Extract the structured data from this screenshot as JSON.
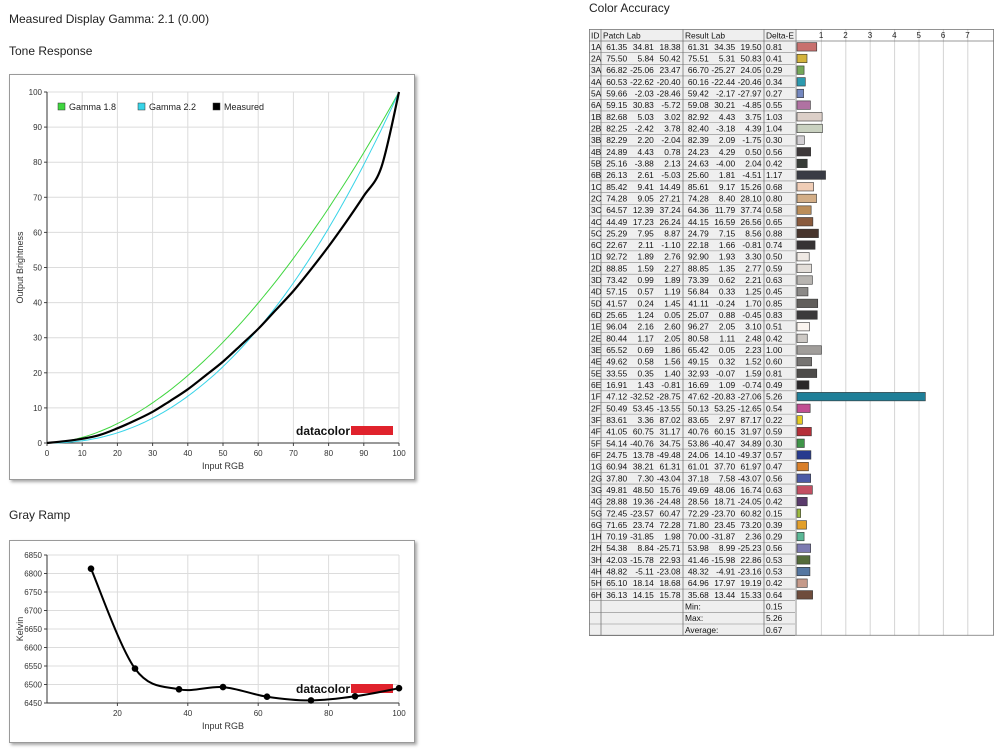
{
  "measured_gamma": "Measured Display Gamma: 2.1 (0.00)",
  "tone_response": {
    "heading": "Tone Response",
    "brand": "datacolor",
    "chart_data": {
      "type": "line",
      "title": "",
      "xlabel": "Input RGB",
      "ylabel": "Output Brightness",
      "xlim": [
        0,
        100
      ],
      "ylim": [
        0,
        100
      ],
      "xticks": [
        0,
        10,
        20,
        30,
        40,
        50,
        60,
        70,
        80,
        90,
        100
      ],
      "yticks": [
        0,
        10,
        20,
        30,
        40,
        50,
        60,
        70,
        80,
        90,
        100
      ],
      "grid": true,
      "legend_position": "top-left",
      "series": [
        {
          "name": "Gamma 1.8",
          "color": "#3fd63f",
          "gamma": 1.8
        },
        {
          "name": "Gamma 2.2",
          "color": "#38d4e8",
          "gamma": 2.2
        },
        {
          "name": "Measured",
          "color": "#000000",
          "x": [
            0,
            5,
            10,
            15,
            20,
            25,
            30,
            35,
            40,
            45,
            50,
            55,
            60,
            65,
            70,
            75,
            80,
            85,
            90,
            95,
            100
          ],
          "y": [
            0,
            0.5,
            1.2,
            2.3,
            4.2,
            6.4,
            8.9,
            12.0,
            15.3,
            19.2,
            23.2,
            27.8,
            32.5,
            37.9,
            43.3,
            49.5,
            56.0,
            63.0,
            70.4,
            78.6,
            100
          ]
        }
      ]
    }
  },
  "gray_ramp": {
    "heading": "Gray Ramp",
    "brand": "datacolor",
    "chart_data": {
      "type": "line",
      "title": "",
      "xlabel": "Input RGB",
      "ylabel": "Kelvin",
      "xlim": [
        0,
        100
      ],
      "ylim": [
        6450,
        6850
      ],
      "xticks": [
        20,
        40,
        60,
        80,
        100
      ],
      "yticks": [
        6450,
        6500,
        6550,
        6600,
        6650,
        6700,
        6750,
        6800,
        6850
      ],
      "grid": true,
      "series": [
        {
          "color": "#000000",
          "x": [
            12.5,
            25,
            37.5,
            50,
            62.5,
            75,
            87.5,
            100
          ],
          "y": [
            6813,
            6543,
            6487,
            6493,
            6467,
            6457,
            6468,
            6490
          ]
        }
      ]
    }
  },
  "color_accuracy": {
    "heading": "Color Accuracy",
    "col_id": "ID",
    "col_patch": "Patch Lab",
    "col_result": "Result Lab",
    "col_delta": "Delta-E",
    "scale_ticks": [
      "1",
      "2",
      "3",
      "4",
      "5",
      "6",
      "7"
    ],
    "summary": [
      {
        "label": "Min:",
        "value": "0.15"
      },
      {
        "label": "Max:",
        "value": "5.26"
      },
      {
        "label": "Average:",
        "value": "0.67"
      }
    ],
    "chart_data": {
      "type": "table",
      "columns": [
        "ID",
        "Patch Lab",
        "Result Lab",
        "Delta-E"
      ],
      "bar_axis": {
        "min": 0,
        "max": 7
      },
      "rows": [
        {
          "id": "1A",
          "patch": "61.35 34.81 18.38",
          "result": "61.31 34.35 19.50",
          "delta": "0.81",
          "color": "#c8706e"
        },
        {
          "id": "2A",
          "patch": "75.50 5.84 50.42",
          "result": "75.51 5.31 50.83",
          "delta": "0.41",
          "color": "#d4b33c"
        },
        {
          "id": "3A",
          "patch": "66.82 -25.06 23.47",
          "result": "66.70 -25.27 24.05",
          "delta": "0.29",
          "color": "#75a85a"
        },
        {
          "id": "4A",
          "patch": "60.53 -22.62 -20.40",
          "result": "60.16 -22.44 -20.46",
          "delta": "0.34",
          "color": "#2c9aaf"
        },
        {
          "id": "5A",
          "patch": "59.66 -2.03 -28.46",
          "result": "59.42 -2.17 -27.97",
          "delta": "0.27",
          "color": "#7488c0"
        },
        {
          "id": "6A",
          "patch": "59.15 30.83 -5.72",
          "result": "59.08 30.21 -4.85",
          "delta": "0.55",
          "color": "#b072a2"
        },
        {
          "id": "1B",
          "patch": "82.68 5.03 3.02",
          "result": "82.92 4.43 3.75",
          "delta": "1.03",
          "color": "#dccfc8"
        },
        {
          "id": "2B",
          "patch": "82.25 -2.42 3.78",
          "result": "82.40 -3.18 4.39",
          "delta": "1.04",
          "color": "#c9d1c0"
        },
        {
          "id": "3B",
          "patch": "82.29 2.20 -2.04",
          "result": "82.39 2.09 -1.75",
          "delta": "0.30",
          "color": "#d2cfd3"
        },
        {
          "id": "4B",
          "patch": "24.89 4.43 0.78",
          "result": "24.23 4.29 0.50",
          "delta": "0.56",
          "color": "#3e393a"
        },
        {
          "id": "5B",
          "patch": "25.16 -3.88 2.13",
          "result": "24.63 -4.00 2.04",
          "delta": "0.42",
          "color": "#373c37"
        },
        {
          "id": "6B",
          "patch": "26.13 2.61 -5.03",
          "result": "25.60 1.81 -4.51",
          "delta": "1.17",
          "color": "#393b44"
        },
        {
          "id": "1C",
          "patch": "85.42 9.41 14.49",
          "result": "85.61 9.17 15.26",
          "delta": "0.68",
          "color": "#f0cdb6"
        },
        {
          "id": "2C",
          "patch": "74.28 9.05 27.21",
          "result": "74.28 8.40 28.10",
          "delta": "0.80",
          "color": "#d3ae87"
        },
        {
          "id": "3C",
          "patch": "64.57 12.39 37.24",
          "result": "64.36 11.79 37.74",
          "delta": "0.58",
          "color": "#bb8d59"
        },
        {
          "id": "4C",
          "patch": "44.49 17.23 26.24",
          "result": "44.15 16.59 26.56",
          "delta": "0.65",
          "color": "#8a5b3e"
        },
        {
          "id": "5C",
          "patch": "25.29 7.95 8.87",
          "result": "24.79 7.15 8.56",
          "delta": "0.88",
          "color": "#48352d"
        },
        {
          "id": "6C",
          "patch": "22.67 2.11 -1.10",
          "result": "22.18 1.66 -0.81",
          "delta": "0.74",
          "color": "#363334"
        },
        {
          "id": "1D",
          "patch": "92.72 1.89 2.76",
          "result": "92.90 1.93 3.30",
          "delta": "0.50",
          "color": "#efe9e4"
        },
        {
          "id": "2D",
          "patch": "88.85 1.59 2.27",
          "result": "88.85 1.35 2.77",
          "delta": "0.59",
          "color": "#e3ded9"
        },
        {
          "id": "3D",
          "patch": "73.42 0.99 1.89",
          "result": "73.39 0.62 2.21",
          "delta": "0.63",
          "color": "#b7b4b0"
        },
        {
          "id": "4D",
          "patch": "57.15 0.57 1.19",
          "result": "56.84 0.33 1.25",
          "delta": "0.45",
          "color": "#8b8987"
        },
        {
          "id": "5D",
          "patch": "41.57 0.24 1.45",
          "result": "41.11 -0.24 1.70",
          "delta": "0.85",
          "color": "#625f5c"
        },
        {
          "id": "6D",
          "patch": "25.65 1.24 0.05",
          "result": "25.07 0.88 -0.45",
          "delta": "0.83",
          "color": "#3b3a3b"
        },
        {
          "id": "1E",
          "patch": "96.04 2.16 2.60",
          "result": "96.27 2.05 3.10",
          "delta": "0.51",
          "color": "#faf4ef"
        },
        {
          "id": "2E",
          "patch": "80.44 1.17 2.05",
          "result": "80.58 1.11 2.48",
          "delta": "0.42",
          "color": "#cdc9c5"
        },
        {
          "id": "3E",
          "patch": "65.52 0.69 1.86",
          "result": "65.42 0.05 2.23",
          "delta": "1.00",
          "color": "#a09d9a"
        },
        {
          "id": "4E",
          "patch": "49.62 0.58 1.56",
          "result": "49.15 0.32 1.52",
          "delta": "0.60",
          "color": "#767472"
        },
        {
          "id": "5E",
          "patch": "33.55 0.35 1.40",
          "result": "32.93 -0.07 1.59",
          "delta": "0.81",
          "color": "#4e4c4a"
        },
        {
          "id": "6E",
          "patch": "16.91 1.43 -0.81",
          "result": "16.69 1.09 -0.74",
          "delta": "0.49",
          "color": "#2a2829"
        },
        {
          "id": "1F",
          "patch": "47.12 -32.52 -28.75",
          "result": "47.62 -20.83 -27.06",
          "delta": "5.26",
          "color": "#1f7f98"
        },
        {
          "id": "2F",
          "patch": "50.49 53.45 -13.55",
          "result": "50.13 53.25 -12.65",
          "delta": "0.54",
          "color": "#c14e92"
        },
        {
          "id": "3F",
          "patch": "83.61 3.36 87.02",
          "result": "83.65 2.97 87.17",
          "delta": "0.22",
          "color": "#e6cb21"
        },
        {
          "id": "4F",
          "patch": "41.05 60.75 31.17",
          "result": "40.76 60.15 31.97",
          "delta": "0.59",
          "color": "#b52f38"
        },
        {
          "id": "5F",
          "patch": "54.14 -40.76 34.75",
          "result": "53.86 -40.47 34.89",
          "delta": "0.30",
          "color": "#3f9548"
        },
        {
          "id": "6F",
          "patch": "24.75 13.78 -49.48",
          "result": "24.06 14.10 -49.37",
          "delta": "0.57",
          "color": "#263a8e"
        },
        {
          "id": "1G",
          "patch": "60.94 38.21 61.31",
          "result": "61.01 37.70 61.97",
          "delta": "0.47",
          "color": "#d97f2a"
        },
        {
          "id": "2G",
          "patch": "37.80 7.30 -43.04",
          "result": "37.18 7.58 -43.07",
          "delta": "0.56",
          "color": "#4b5aa6"
        },
        {
          "id": "3G",
          "patch": "49.81 48.50 15.76",
          "result": "49.69 48.06 16.74",
          "delta": "0.63",
          "color": "#c24f62"
        },
        {
          "id": "4G",
          "patch": "28.88 19.36 -24.48",
          "result": "28.56 18.71 -24.05",
          "delta": "0.42",
          "color": "#5a3b6c"
        },
        {
          "id": "5G",
          "patch": "72.45 -23.57 60.47",
          "result": "72.29 -23.70 60.82",
          "delta": "0.15",
          "color": "#9cba3f"
        },
        {
          "id": "6G",
          "patch": "71.65 23.74 72.28",
          "result": "71.80 23.45 73.20",
          "delta": "0.39",
          "color": "#e29f2a"
        },
        {
          "id": "1H",
          "patch": "70.19 -31.85 1.98",
          "result": "70.00 -31.87 2.36",
          "delta": "0.29",
          "color": "#5bb896"
        },
        {
          "id": "2H",
          "patch": "54.38 8.84 -25.71",
          "result": "53.98 8.99 -25.23",
          "delta": "0.56",
          "color": "#7d7ab1"
        },
        {
          "id": "3H",
          "patch": "42.03 -15.78 22.93",
          "result": "41.46 -15.98 22.86",
          "delta": "0.53",
          "color": "#546b3a"
        },
        {
          "id": "4H",
          "patch": "48.82 -5.11 -23.08",
          "result": "48.32 -4.91 -23.16",
          "delta": "0.53",
          "color": "#5577a1"
        },
        {
          "id": "5H",
          "patch": "65.10 18.14 18.68",
          "result": "64.96 17.97 19.19",
          "delta": "0.42",
          "color": "#c59a8a"
        },
        {
          "id": "6H",
          "patch": "36.13 14.15 15.78",
          "result": "35.68 13.44 15.33",
          "delta": "0.64",
          "color": "#6e4c3c"
        }
      ]
    }
  }
}
